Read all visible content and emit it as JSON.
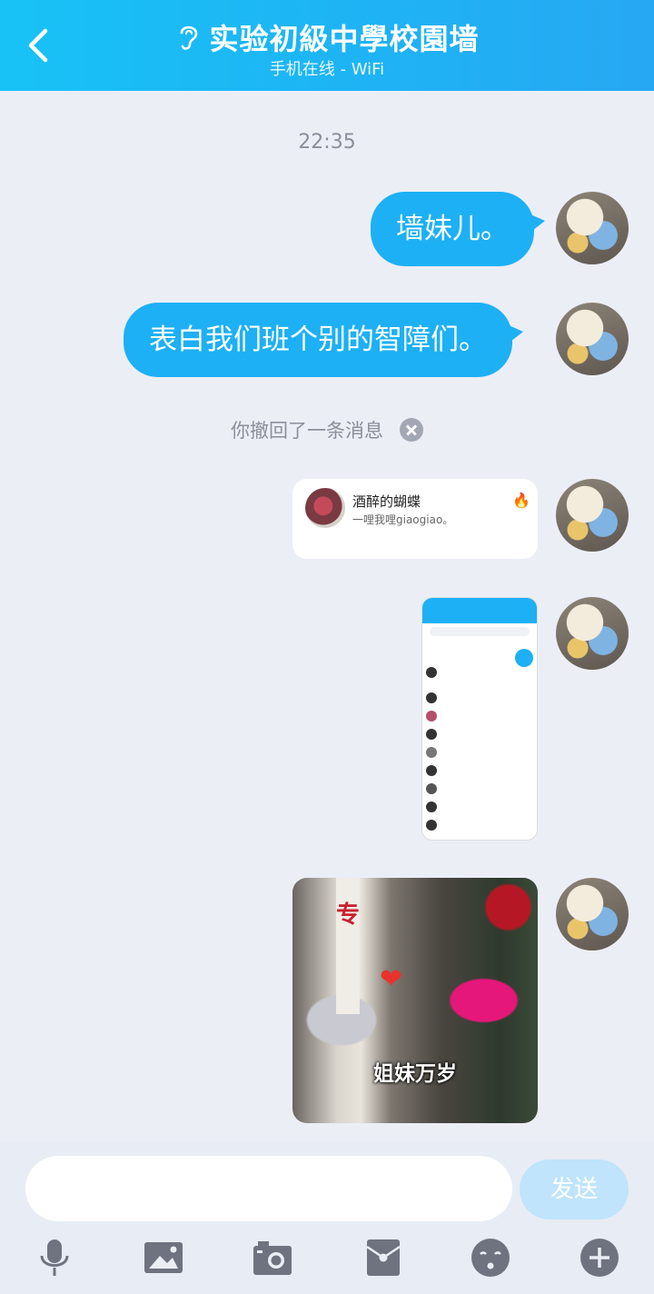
{
  "header": {
    "title": "实验初級中學校園墙",
    "subtitle": "手机在线 - WiFi"
  },
  "chat": {
    "timestamp": "22:35",
    "messages": [
      {
        "type": "text",
        "text": "墙妹儿。"
      },
      {
        "type": "text",
        "text": "表白我们班个别的智障们。"
      }
    ],
    "recall_notice": "你撤回了一条消息",
    "contact_card": {
      "name": "酒醉的蝴蝶",
      "signature": "一哩我哩giaogiao。"
    },
    "photo_caption": "姐妹万岁",
    "photo_sign": "专"
  },
  "input_bar": {
    "placeholder": "",
    "send_label": "发送"
  },
  "toolbar": {
    "icons": [
      "microphone-icon",
      "image-icon",
      "camera-icon",
      "red-packet-icon",
      "emoji-icon",
      "plus-icon"
    ]
  },
  "colors": {
    "header": "#1db0f5",
    "bubble": "#1db0f5",
    "background": "#eceef6",
    "send_disabled": "#bfe4fb"
  }
}
